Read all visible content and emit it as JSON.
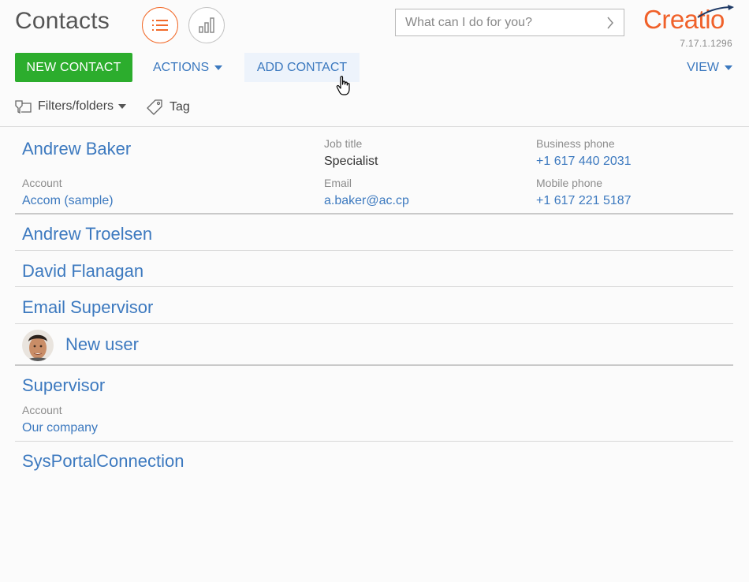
{
  "header": {
    "title": "Contacts",
    "list_view_icon": "list-icon",
    "analytics_view_icon": "bar-chart-icon",
    "search": {
      "placeholder": "What can I do for you?",
      "icon": "chevron-right-icon"
    },
    "logo_text": "Creatio",
    "version": "7.17.1.1296"
  },
  "toolbar": {
    "new_contact_label": "NEW CONTACT",
    "actions_label": "ACTIONS",
    "add_contact_label": "ADD CONTACT",
    "view_label": "VIEW"
  },
  "filters": {
    "filters_label": "Filters/folders",
    "tag_label": "Tag"
  },
  "contacts": [
    {
      "name": "Andrew Baker",
      "account_caption": "Account",
      "account": "Accom (sample)",
      "job_title_caption": "Job title",
      "job_title": "Specialist",
      "email_caption": "Email",
      "email": "a.baker@ac.cp",
      "business_phone_caption": "Business phone",
      "business_phone": "+1 617 440 2031",
      "mobile_phone_caption": "Mobile phone",
      "mobile_phone": "+1 617 221 5187"
    },
    {
      "name": "Andrew Troelsen"
    },
    {
      "name": "David Flanagan"
    },
    {
      "name": "Email Supervisor"
    },
    {
      "name": "New user"
    },
    {
      "name": "Supervisor",
      "account_caption": "Account",
      "account": "Our company"
    },
    {
      "name": "SysPortalConnection"
    }
  ],
  "colors": {
    "accent_orange": "#f26b2b",
    "new_button_green": "#2cad2d",
    "link_blue": "#3c79bf",
    "logo_orange": "#f0612a"
  }
}
